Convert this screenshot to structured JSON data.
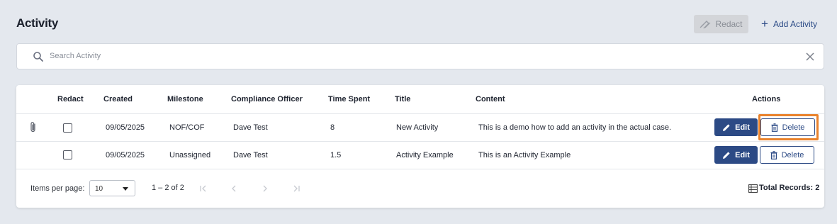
{
  "header": {
    "title": "Activity",
    "redact_label": "Redact",
    "add_label": "Add Activity"
  },
  "search": {
    "placeholder": "Search Activity"
  },
  "table": {
    "columns": {
      "redact": "Redact",
      "created": "Created",
      "milestone": "Milestone",
      "compliance_officer": "Compliance Officer",
      "time_spent": "Time Spent",
      "title": "Title",
      "content": "Content",
      "actions": "Actions"
    },
    "rows": [
      {
        "has_attachment": true,
        "redact_checked": false,
        "created": "09/05/2025",
        "milestone": "NOF/COF",
        "compliance_officer": "Dave Test",
        "time_spent": "8",
        "title": "New Activity",
        "content": "This is a demo how to add an activity in the actual case.",
        "edit_label": "Edit",
        "delete_label": "Delete",
        "delete_highlighted": true
      },
      {
        "has_attachment": false,
        "redact_checked": false,
        "created": "09/05/2025",
        "milestone": "Unassigned",
        "compliance_officer": "Dave Test",
        "time_spent": "1.5",
        "title": "Activity Example",
        "content": "This is an Activity Example",
        "edit_label": "Edit",
        "delete_label": "Delete",
        "delete_highlighted": false
      }
    ]
  },
  "footer": {
    "items_per_page_label": "Items per page:",
    "items_per_page_value": "10",
    "range_label": "1 – 2 of 2",
    "total_records_label": "Total Records: 2"
  },
  "colors": {
    "primary": "#2c4a85",
    "highlight": "#e9822c",
    "background": "#e4e8ee"
  }
}
